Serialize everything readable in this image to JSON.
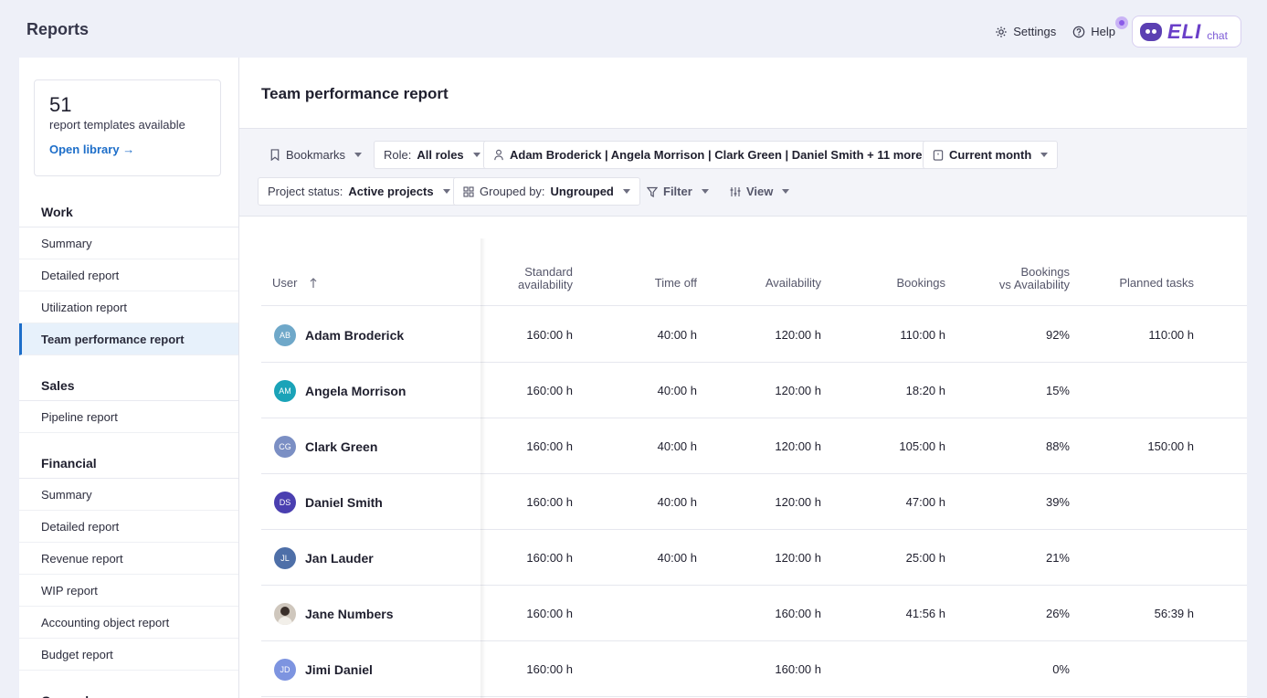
{
  "header": {
    "title": "Reports",
    "settings_label": "Settings",
    "help_label": "Help",
    "eli_word": "ELI",
    "eli_sub": "chat"
  },
  "sidebar": {
    "library": {
      "count": "51",
      "text": "report templates available",
      "link": "Open library →"
    },
    "sections": [
      {
        "title": "Work",
        "items": [
          "Summary",
          "Detailed report",
          "Utilization report",
          "Team performance report"
        ]
      },
      {
        "title": "Sales",
        "items": [
          "Pipeline report"
        ]
      },
      {
        "title": "Financial",
        "items": [
          "Summary",
          "Detailed report",
          "Revenue report",
          "WIP report",
          "Accounting object report",
          "Budget report"
        ]
      },
      {
        "title": "General",
        "items": []
      }
    ],
    "active_item": "Team performance report"
  },
  "main": {
    "title": "Team performance report",
    "filters": {
      "bookmarks": "Bookmarks",
      "role_label": "Role:",
      "role_value": "All roles",
      "users_value": "Adam Broderick | Angela Morrison | Clark Green | Daniel Smith + 11 more",
      "period_value": "Current month",
      "status_label": "Project status:",
      "status_value": "Active projects",
      "group_label": "Grouped by:",
      "group_value": "Ungrouped",
      "filter_label": "Filter",
      "view_label": "View"
    },
    "table": {
      "columns": {
        "user": "User",
        "standard_1": "Standard",
        "standard_2": "availability",
        "time_off": "Time off",
        "availability": "Availability",
        "bookings": "Bookings",
        "bva_1": "Bookings",
        "bva_2": "vs Availability",
        "planned": "Planned tasks"
      },
      "rows": [
        {
          "initials": "AB",
          "name": "Adam Broderick",
          "standard": "160:00 h",
          "time_off": "40:00 h",
          "availability": "120:00 h",
          "bookings": "110:00 h",
          "bva": "92%",
          "planned": "110:00 h",
          "color": "#6fa8c9"
        },
        {
          "initials": "AM",
          "name": "Angela Morrison",
          "standard": "160:00 h",
          "time_off": "40:00 h",
          "availability": "120:00 h",
          "bookings": "18:20 h",
          "bva": "15%",
          "planned": "",
          "color": "#1aa3b8"
        },
        {
          "initials": "CG",
          "name": "Clark Green",
          "standard": "160:00 h",
          "time_off": "40:00 h",
          "availability": "120:00 h",
          "bookings": "105:00 h",
          "bva": "88%",
          "planned": "150:00 h",
          "color": "#7b8fc4"
        },
        {
          "initials": "DS",
          "name": "Daniel Smith",
          "standard": "160:00 h",
          "time_off": "40:00 h",
          "availability": "120:00 h",
          "bookings": "47:00 h",
          "bva": "39%",
          "planned": "",
          "color": "#4a3fb0"
        },
        {
          "initials": "JL",
          "name": "Jan Lauder",
          "standard": "160:00 h",
          "time_off": "40:00 h",
          "availability": "120:00 h",
          "bookings": "25:00 h",
          "bva": "21%",
          "planned": "",
          "color": "#4e6fa8"
        },
        {
          "initials": "",
          "name": "Jane Numbers",
          "standard": "160:00 h",
          "time_off": "",
          "availability": "160:00 h",
          "bookings": "41:56 h",
          "bva": "26%",
          "planned": "56:39 h",
          "color": "#cfc7bd"
        },
        {
          "initials": "JD",
          "name": "Jimi Daniel",
          "standard": "160:00 h",
          "time_off": "",
          "availability": "160:00 h",
          "bookings": "",
          "bva": "0%",
          "planned": "",
          "color": "#7d94e0"
        }
      ]
    }
  }
}
